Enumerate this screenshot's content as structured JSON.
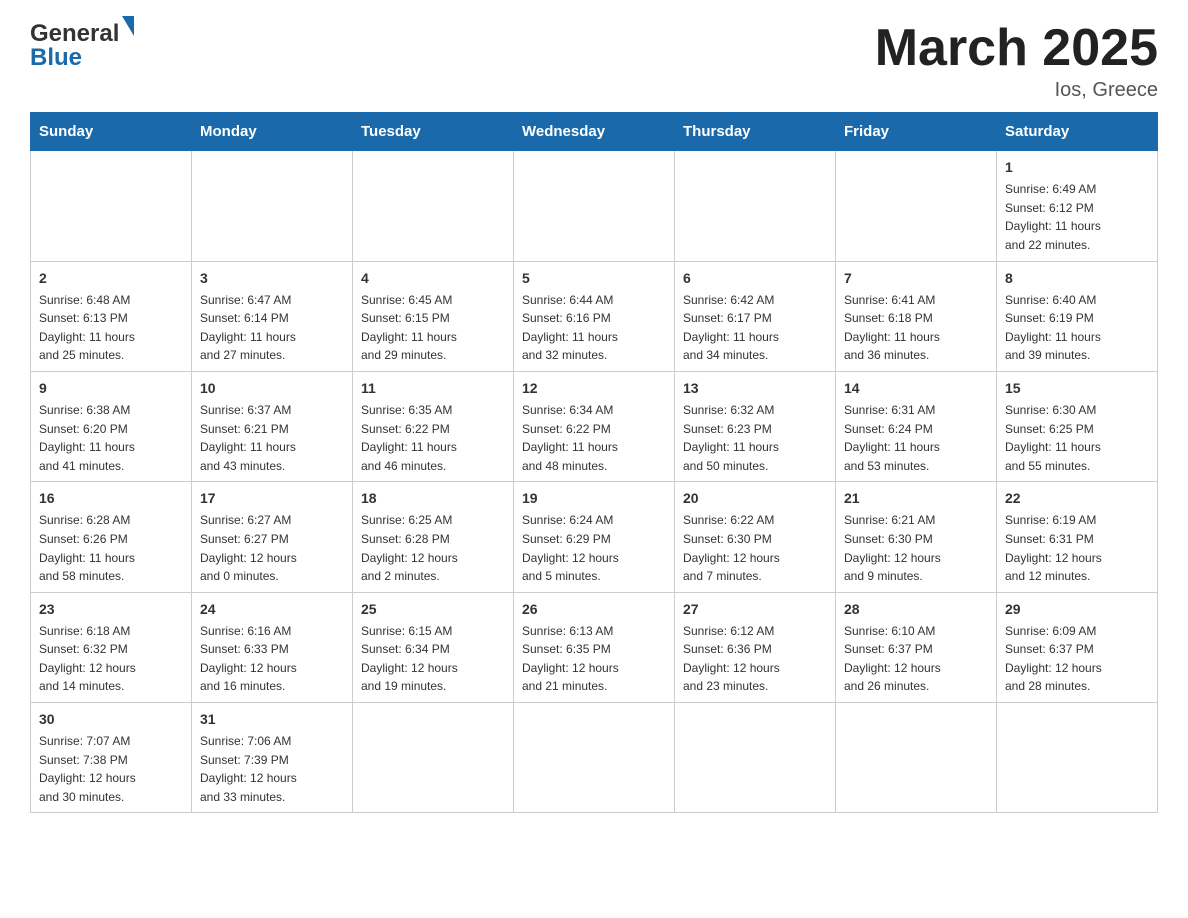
{
  "header": {
    "logo_line1": "General",
    "logo_line2": "Blue",
    "month_title": "March 2025",
    "subtitle": "Ios, Greece"
  },
  "calendar": {
    "days_of_week": [
      "Sunday",
      "Monday",
      "Tuesday",
      "Wednesday",
      "Thursday",
      "Friday",
      "Saturday"
    ],
    "weeks": [
      [
        {
          "day": "",
          "info": ""
        },
        {
          "day": "",
          "info": ""
        },
        {
          "day": "",
          "info": ""
        },
        {
          "day": "",
          "info": ""
        },
        {
          "day": "",
          "info": ""
        },
        {
          "day": "",
          "info": ""
        },
        {
          "day": "1",
          "info": "Sunrise: 6:49 AM\nSunset: 6:12 PM\nDaylight: 11 hours\nand 22 minutes."
        }
      ],
      [
        {
          "day": "2",
          "info": "Sunrise: 6:48 AM\nSunset: 6:13 PM\nDaylight: 11 hours\nand 25 minutes."
        },
        {
          "day": "3",
          "info": "Sunrise: 6:47 AM\nSunset: 6:14 PM\nDaylight: 11 hours\nand 27 minutes."
        },
        {
          "day": "4",
          "info": "Sunrise: 6:45 AM\nSunset: 6:15 PM\nDaylight: 11 hours\nand 29 minutes."
        },
        {
          "day": "5",
          "info": "Sunrise: 6:44 AM\nSunset: 6:16 PM\nDaylight: 11 hours\nand 32 minutes."
        },
        {
          "day": "6",
          "info": "Sunrise: 6:42 AM\nSunset: 6:17 PM\nDaylight: 11 hours\nand 34 minutes."
        },
        {
          "day": "7",
          "info": "Sunrise: 6:41 AM\nSunset: 6:18 PM\nDaylight: 11 hours\nand 36 minutes."
        },
        {
          "day": "8",
          "info": "Sunrise: 6:40 AM\nSunset: 6:19 PM\nDaylight: 11 hours\nand 39 minutes."
        }
      ],
      [
        {
          "day": "9",
          "info": "Sunrise: 6:38 AM\nSunset: 6:20 PM\nDaylight: 11 hours\nand 41 minutes."
        },
        {
          "day": "10",
          "info": "Sunrise: 6:37 AM\nSunset: 6:21 PM\nDaylight: 11 hours\nand 43 minutes."
        },
        {
          "day": "11",
          "info": "Sunrise: 6:35 AM\nSunset: 6:22 PM\nDaylight: 11 hours\nand 46 minutes."
        },
        {
          "day": "12",
          "info": "Sunrise: 6:34 AM\nSunset: 6:22 PM\nDaylight: 11 hours\nand 48 minutes."
        },
        {
          "day": "13",
          "info": "Sunrise: 6:32 AM\nSunset: 6:23 PM\nDaylight: 11 hours\nand 50 minutes."
        },
        {
          "day": "14",
          "info": "Sunrise: 6:31 AM\nSunset: 6:24 PM\nDaylight: 11 hours\nand 53 minutes."
        },
        {
          "day": "15",
          "info": "Sunrise: 6:30 AM\nSunset: 6:25 PM\nDaylight: 11 hours\nand 55 minutes."
        }
      ],
      [
        {
          "day": "16",
          "info": "Sunrise: 6:28 AM\nSunset: 6:26 PM\nDaylight: 11 hours\nand 58 minutes."
        },
        {
          "day": "17",
          "info": "Sunrise: 6:27 AM\nSunset: 6:27 PM\nDaylight: 12 hours\nand 0 minutes."
        },
        {
          "day": "18",
          "info": "Sunrise: 6:25 AM\nSunset: 6:28 PM\nDaylight: 12 hours\nand 2 minutes."
        },
        {
          "day": "19",
          "info": "Sunrise: 6:24 AM\nSunset: 6:29 PM\nDaylight: 12 hours\nand 5 minutes."
        },
        {
          "day": "20",
          "info": "Sunrise: 6:22 AM\nSunset: 6:30 PM\nDaylight: 12 hours\nand 7 minutes."
        },
        {
          "day": "21",
          "info": "Sunrise: 6:21 AM\nSunset: 6:30 PM\nDaylight: 12 hours\nand 9 minutes."
        },
        {
          "day": "22",
          "info": "Sunrise: 6:19 AM\nSunset: 6:31 PM\nDaylight: 12 hours\nand 12 minutes."
        }
      ],
      [
        {
          "day": "23",
          "info": "Sunrise: 6:18 AM\nSunset: 6:32 PM\nDaylight: 12 hours\nand 14 minutes."
        },
        {
          "day": "24",
          "info": "Sunrise: 6:16 AM\nSunset: 6:33 PM\nDaylight: 12 hours\nand 16 minutes."
        },
        {
          "day": "25",
          "info": "Sunrise: 6:15 AM\nSunset: 6:34 PM\nDaylight: 12 hours\nand 19 minutes."
        },
        {
          "day": "26",
          "info": "Sunrise: 6:13 AM\nSunset: 6:35 PM\nDaylight: 12 hours\nand 21 minutes."
        },
        {
          "day": "27",
          "info": "Sunrise: 6:12 AM\nSunset: 6:36 PM\nDaylight: 12 hours\nand 23 minutes."
        },
        {
          "day": "28",
          "info": "Sunrise: 6:10 AM\nSunset: 6:37 PM\nDaylight: 12 hours\nand 26 minutes."
        },
        {
          "day": "29",
          "info": "Sunrise: 6:09 AM\nSunset: 6:37 PM\nDaylight: 12 hours\nand 28 minutes."
        }
      ],
      [
        {
          "day": "30",
          "info": "Sunrise: 7:07 AM\nSunset: 7:38 PM\nDaylight: 12 hours\nand 30 minutes."
        },
        {
          "day": "31",
          "info": "Sunrise: 7:06 AM\nSunset: 7:39 PM\nDaylight: 12 hours\nand 33 minutes."
        },
        {
          "day": "",
          "info": ""
        },
        {
          "day": "",
          "info": ""
        },
        {
          "day": "",
          "info": ""
        },
        {
          "day": "",
          "info": ""
        },
        {
          "day": "",
          "info": ""
        }
      ]
    ]
  }
}
